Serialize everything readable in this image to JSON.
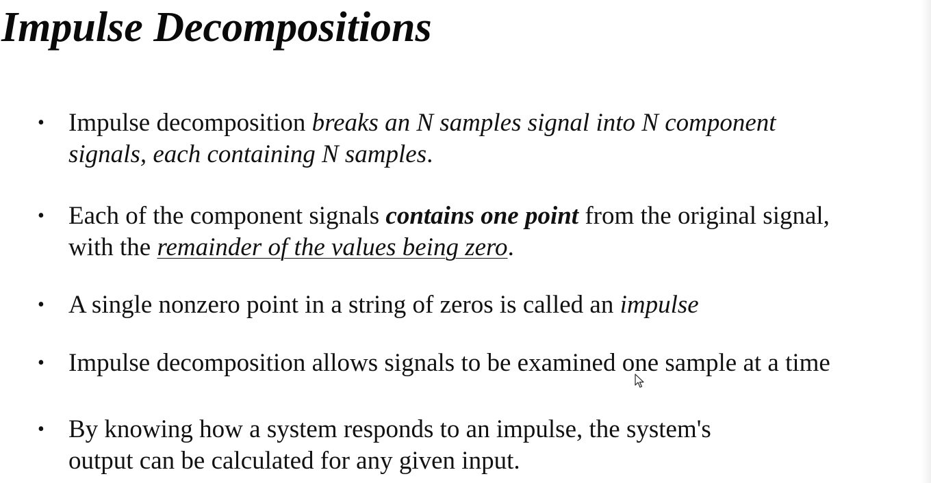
{
  "slide": {
    "title": "Impulse Decompositions",
    "bullets": [
      {
        "line1_a": "Impulse decomposition ",
        "line1_b": "breaks an N samples signal into N component",
        "line2_a": "signals, each containing N samples",
        "line2_b": "."
      },
      {
        "line1_a": "Each of the component signals ",
        "line1_b": "contains one point",
        "line1_c": " from the original signal,",
        "line2_a": "with the ",
        "line2_b": "remainder of the values being zero",
        "line2_c": "."
      },
      {
        "line1_a": "A single nonzero point in a string of zeros is called an ",
        "line1_b": "impulse"
      },
      {
        "line1_a": "Impulse decomposition allows signals to be examined one sample at a time"
      },
      {
        "line1_a": "By knowing how a system responds to an impulse, the system's",
        "line2_a": "output can be calculated for any given input."
      }
    ],
    "bullet_symbol": "•"
  },
  "icons": {
    "cursor": "mouse-pointer-icon"
  }
}
